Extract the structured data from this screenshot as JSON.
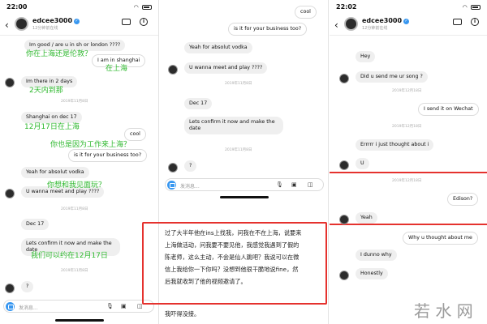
{
  "status": {
    "p1_time": "22:00",
    "p3_time": "22:02"
  },
  "header": {
    "username": "edcee3000",
    "verified_mark": "✓",
    "subtitle": "12分钟前在线"
  },
  "icons": [
    "chevron-left-icon",
    "video-call-icon",
    "info-icon",
    "camera-icon",
    "microphone-icon",
    "image-icon",
    "sticker-icon",
    "search-icon",
    "wifi-icon",
    "battery-icon"
  ],
  "colors": {
    "accent": "#3897f0",
    "overlay_text": "#2eb82e",
    "highlight_box": "#e5322e"
  },
  "composer": {
    "placeholder": "发消息..."
  },
  "panel1": {
    "messages": [
      {
        "text": "Im good / are u in sh or london ????"
      },
      {
        "text": "I am in shanghai"
      },
      {
        "text": "Im there in 2 days"
      },
      {
        "text": "Shanghai on dec 17"
      },
      {
        "text": "cool"
      },
      {
        "text": "is it for your business too?"
      },
      {
        "text": "Yeah for absolut vodka"
      },
      {
        "text": "U wanna meet and play ????"
      },
      {
        "text": "Dec 17"
      },
      {
        "text": "Lets confirm it now and make the date"
      },
      {
        "text": "?"
      }
    ],
    "timestamps": [
      "2019年11月8日",
      "2019年11月8日",
      "2019年11月8日"
    ],
    "translations": [
      "你在上海还是伦敦？",
      "在上海",
      "2天内到那",
      "12月17日在上海",
      "你也是因为工作来上海？",
      "你想和我见面玩？",
      "我们可以约在12月17日"
    ]
  },
  "panel2": {
    "messages": [
      {
        "text": "cool"
      },
      {
        "text": "is it for your business too?"
      },
      {
        "text": "Yeah for absolut vodka"
      },
      {
        "text": "U wanna meet and play ????"
      },
      {
        "text": "Dec 17"
      },
      {
        "text": "Lets confirm it now and make the date"
      },
      {
        "text": "?"
      }
    ],
    "timestamps": [
      "2019年11月8日",
      "2019年11月8日"
    ],
    "note_lines": [
      "过了大半年他在ins上找我，问我在不在上海，说要来",
      "上海做活动，问我要不要见他，我感觉我遇到了假的",
      "陈老师，这么主动，不会是仙人跳吧？我说可以在微",
      "信上我给你一下你吗？没想到他很干脆地说fine，然",
      "后我就收到了他的视频邀请了。"
    ],
    "note_after": "我吓得没接。"
  },
  "panel3": {
    "messages": [
      {
        "text": "Hey"
      },
      {
        "text": "Did u send me ur song ?"
      },
      {
        "text": "I send it on Wechat"
      },
      {
        "text": "Errrrr i just thought about i"
      },
      {
        "text": "U"
      },
      {
        "text": "Edison?"
      },
      {
        "text": "Yeah"
      },
      {
        "text": "Why u thought about me"
      },
      {
        "text": "I dunno why"
      },
      {
        "text": "Honestly"
      }
    ],
    "timestamps": [
      "2019年12月18日",
      "2019年12月18日",
      "2019年12月18日"
    ],
    "watermark": "若 水 网"
  }
}
